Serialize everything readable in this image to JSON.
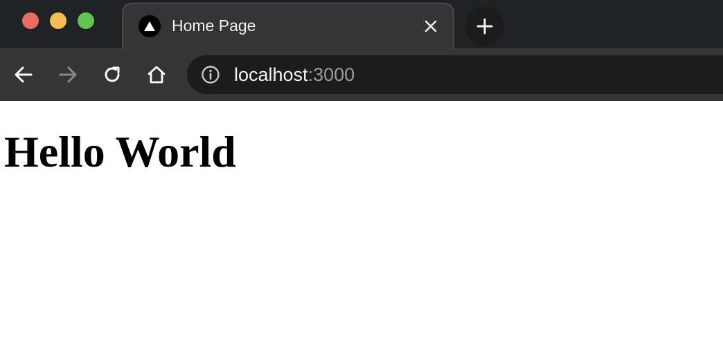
{
  "window": {
    "traffic_lights": [
      {
        "name": "close",
        "color": "#ed6a5e"
      },
      {
        "name": "minimize",
        "color": "#f5bf4f"
      },
      {
        "name": "zoom",
        "color": "#61c554"
      }
    ]
  },
  "tabs": [
    {
      "title": "Home Page",
      "favicon": "triangle-logo-icon",
      "active": true
    }
  ],
  "toolbar": {
    "icons": [
      "arrow-left-icon",
      "arrow-right-icon",
      "reload-icon",
      "home-icon"
    ],
    "forward_enabled": false
  },
  "address_bar": {
    "icon": "info-icon",
    "host": "localhost",
    "port": ":3000"
  },
  "page": {
    "heading": "Hello World"
  }
}
